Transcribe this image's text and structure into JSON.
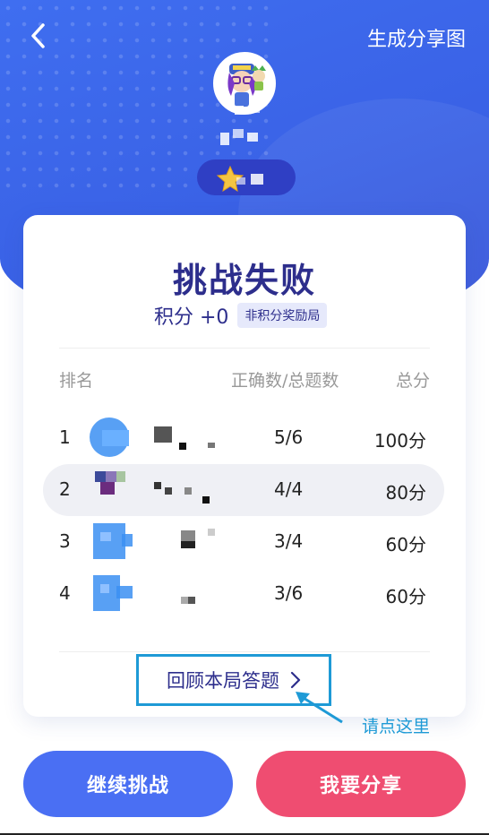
{
  "header": {
    "share_image_label": "生成分享图"
  },
  "result": {
    "title": "挑战失败",
    "score_text": "积分 +0",
    "score_tag": "非积分奖励局"
  },
  "table": {
    "headers": {
      "rank": "排名",
      "correct": "正确数/总题数",
      "total": "总分"
    },
    "rows": [
      {
        "rank": "1",
        "correct": "5/6",
        "total": "100分"
      },
      {
        "rank": "2",
        "correct": "4/4",
        "total": "80分"
      },
      {
        "rank": "3",
        "correct": "3/4",
        "total": "60分"
      },
      {
        "rank": "4",
        "correct": "3/6",
        "total": "60分"
      }
    ]
  },
  "review": {
    "label": "回顾本局答题"
  },
  "annotation": {
    "hint": "请点这里"
  },
  "actions": {
    "continue_label": "继续挑战",
    "share_label": "我要分享"
  },
  "colors": {
    "header_blue": "#3f6ef0",
    "title_navy": "#2d2e8c",
    "continue_blue": "#4a6ff3",
    "share_pink": "#ef4d71",
    "annotation_blue": "#1e9ad6"
  },
  "icons": {
    "back": "chevron-left-icon",
    "review_arrow": "chevron-right-icon",
    "badge": "star-icon"
  }
}
